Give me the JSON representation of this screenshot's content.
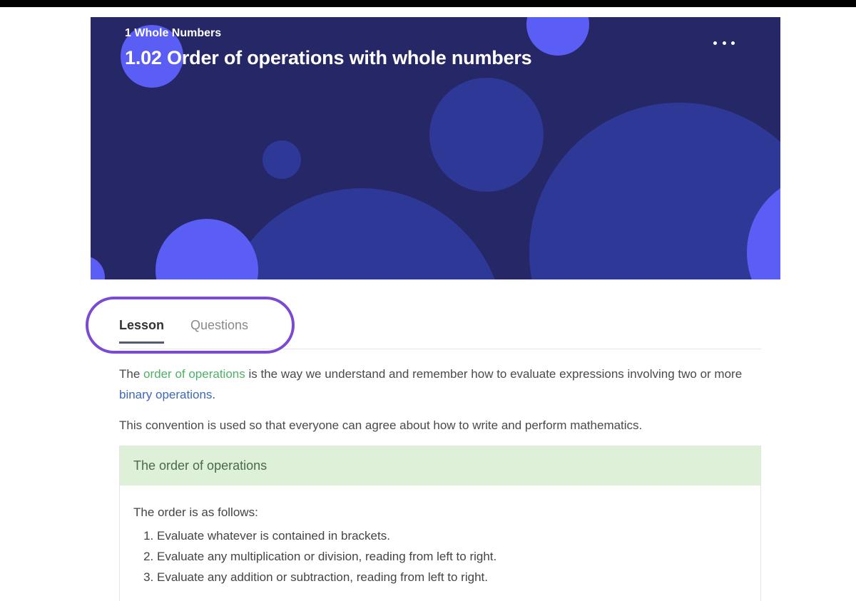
{
  "banner": {
    "breadcrumb": "1 Whole Numbers",
    "title": "1.02 Order of operations with whole numbers",
    "more_icon": "more-horizontal-icon",
    "bg_color": "#262766",
    "accent_color": "#5b5ef5"
  },
  "tabs": [
    {
      "label": "Lesson",
      "active": true
    },
    {
      "label": "Questions",
      "active": false
    }
  ],
  "lesson": {
    "para1_before": "The ",
    "para1_link1": "order of operations",
    "para1_middle": " is the way we understand and remember how to evaluate expressions involving two or more ",
    "para1_link2": "binary operations",
    "para1_after": ".",
    "para2": "This convention is used so that everyone can agree about how to write and perform mathematics."
  },
  "callout": {
    "title": "The order of operations",
    "intro": "The order is as follows:",
    "steps": [
      "Evaluate whatever is contained in brackets.",
      "Evaluate any multiplication or division, reading from left to right.",
      "Evaluate any addition or subtraction, reading from left to right."
    ],
    "header_color": "#dff0d8"
  },
  "highlight_color": "#7b4ad3"
}
